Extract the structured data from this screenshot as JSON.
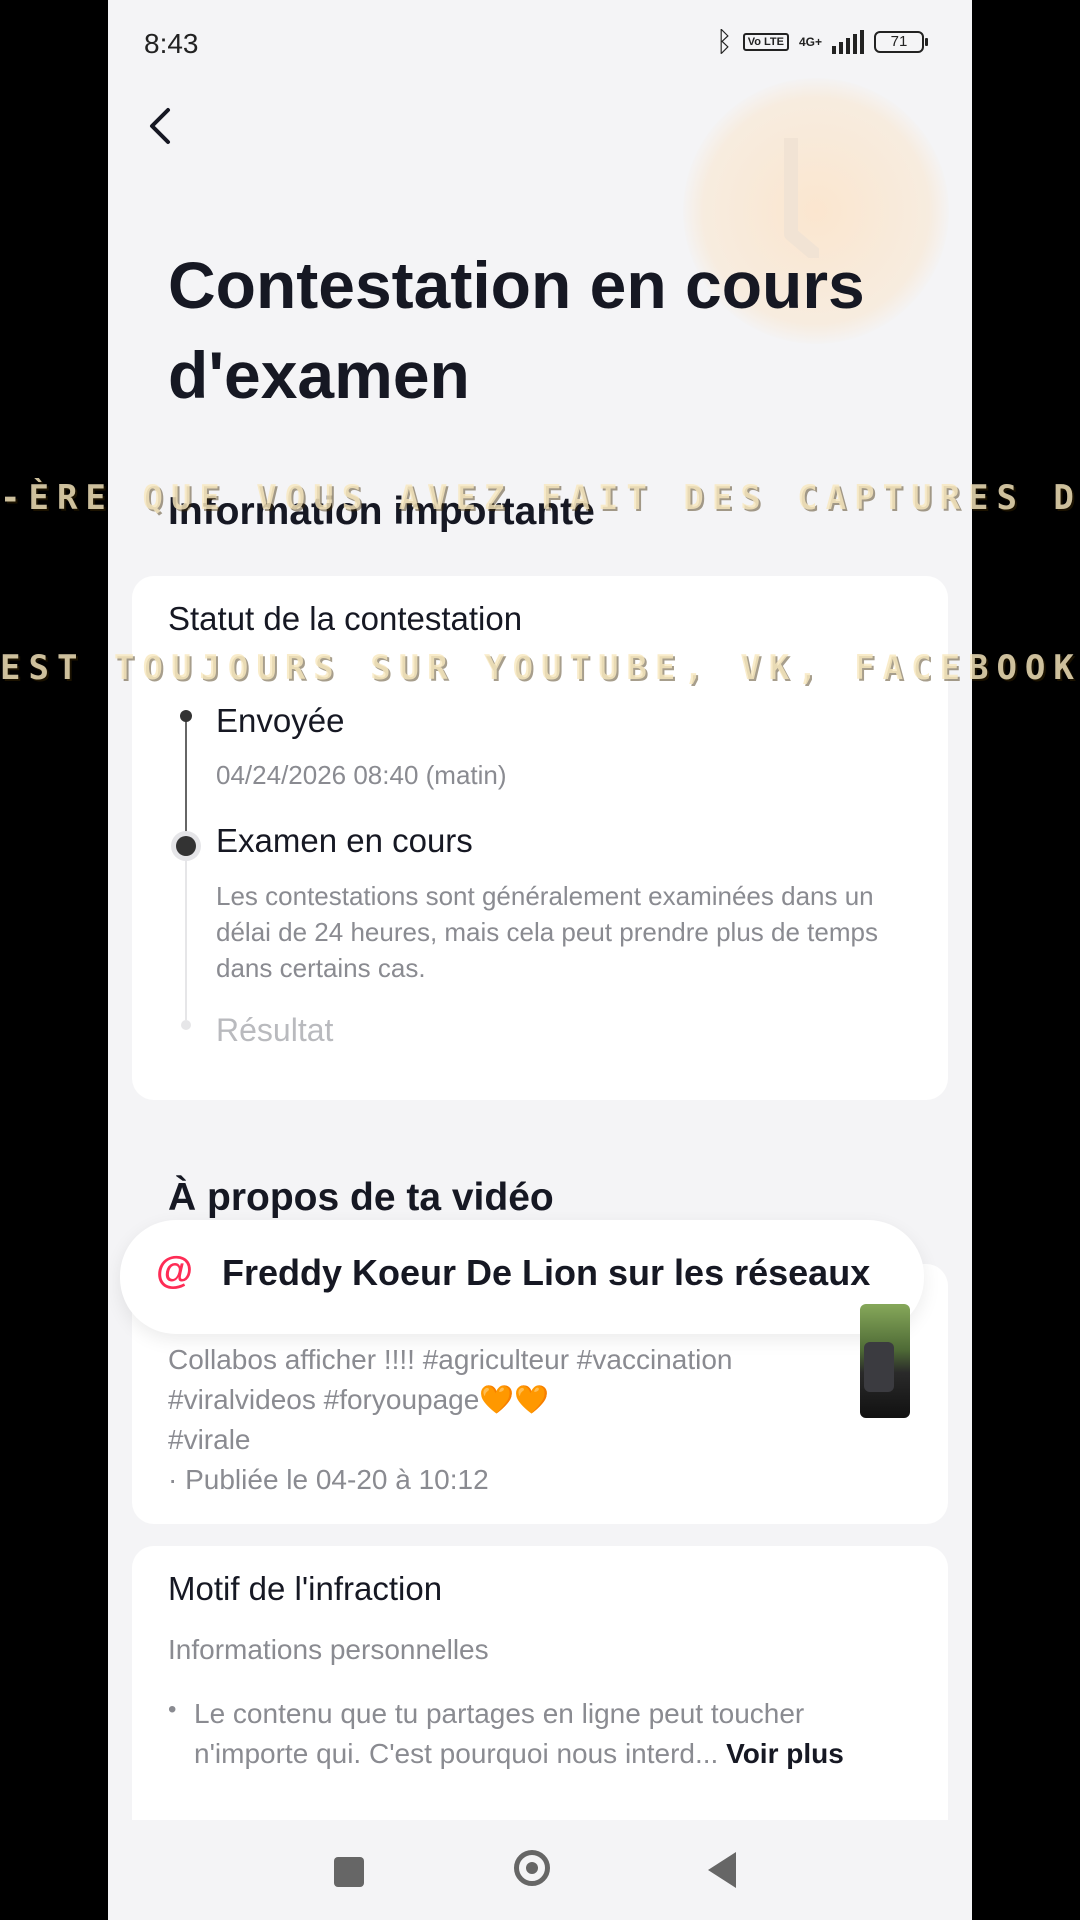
{
  "statusbar": {
    "time": "8:43",
    "network": "4G+",
    "volte": "Vo LTE",
    "battery": "71"
  },
  "header": {
    "title": "Contestation en cours d'examen"
  },
  "important": {
    "heading": "Information importante"
  },
  "status_card": {
    "title": "Statut de la contestation",
    "steps": [
      {
        "label": "Envoyée",
        "sub": "04/24/2026 08:40 (matin)"
      },
      {
        "label": "Examen en cours",
        "desc": "Les contestations sont généralement examinées dans un délai de 24 heures, mais cela peut prendre plus de temps dans certains cas."
      },
      {
        "label": "Résultat"
      }
    ]
  },
  "video": {
    "heading": "À propos de ta vidéo",
    "popup": "Freddy Koeur De Lion sur les réseaux",
    "caption": "Collabos afficher !!!! #agriculteur #vaccination #viralvideos #foryoupage",
    "hearts": "🧡🧡",
    "tag": "#virale",
    "published": "· Publiée le 04-20 à 10:12"
  },
  "infraction": {
    "title": "Motif de l'infraction",
    "type": "Informations personnelles",
    "body": "Le contenu que tu partages en ligne peut toucher n'importe qui. C'est pourquoi nous interd...",
    "more": "Voir plus"
  },
  "overlay": {
    "line1": "-ÈRE QUE VOUS AVEZ FAIT DES CAPTURES D'É",
    "line2": "EST TOUJOURS SUR YOUTUBE, VK, FACEBOOK ET"
  },
  "colors": {
    "accent": "#fe2c55",
    "text": "#161823",
    "muted": "#8a8b91",
    "background": "#f4f4f6"
  }
}
